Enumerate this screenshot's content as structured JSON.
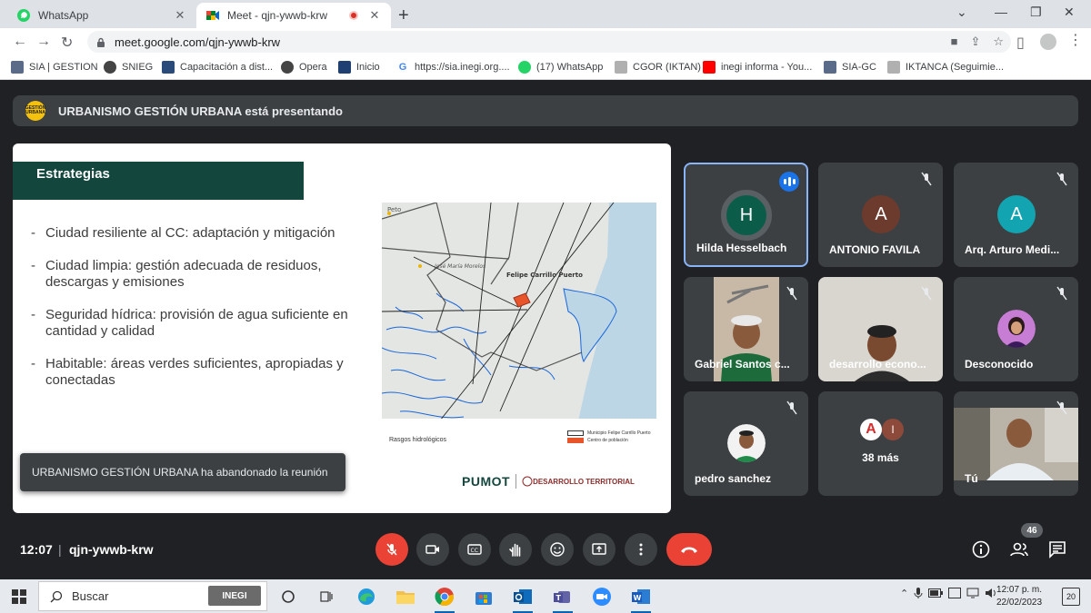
{
  "browser": {
    "tabs": [
      {
        "title": "WhatsApp",
        "active": false
      },
      {
        "title": "Meet - qjn-ywwb-krw",
        "active": true
      }
    ],
    "url": "meet.google.com/qjn-ywwb-krw",
    "bookmarks": [
      "SIA | GESTION",
      "SNIEG",
      "Capacitación a dist...",
      "Opera",
      "Inicio",
      "https://sia.inegi.org....",
      "(17) WhatsApp",
      "CGOR (IKTAN)",
      "inegi informa - You...",
      "SIA-GC",
      "IKTANCA (Seguimie..."
    ]
  },
  "meet": {
    "presenting_text": "URBANISMO GESTIÓN URBANA está presentando",
    "presenter_logo_text": "GESTIÓN URBANA",
    "slide": {
      "title": "Estrategias",
      "bullets": [
        "Ciudad resiliente al CC: adaptación y mitigación",
        "Ciudad limpia: gestión adecuada de residuos, descargas y emisiones",
        "Seguridad hídrica: provisión de agua suficiente en cantidad y calidad",
        "Habitable: áreas verdes suficientes, apropiadas y conectadas"
      ],
      "map_labels": {
        "peto": "Peto",
        "jose_maria": "José María Morelos",
        "felipe": "Felipe Carrillo Puerto"
      },
      "map_caption": "Rasgos hidrológicos",
      "map_legend": [
        "Municipio Felipe Carrillo Puerto",
        "Centro de población"
      ],
      "footer_brand": "PUMOT",
      "footer_org": "DESARROLLO TERRITORIAL"
    },
    "toast": "URBANISMO GESTIÓN URBANA ha abandonado la reunión",
    "participants": [
      {
        "name": "Hilda Hesselbach",
        "initial": "H",
        "color": "#0b5d4a"
      },
      {
        "name": "ANTONIO FAVILA",
        "initial": "A",
        "color": "#6d3b2e"
      },
      {
        "name": "Arq. Arturo Medi...",
        "initial": "A",
        "color": "#12a4b0"
      },
      {
        "name": "Gabriel Santos c..."
      },
      {
        "name": "desarrollo econo..."
      },
      {
        "name": "Desconocido"
      },
      {
        "name": "pedro sanchez"
      },
      {
        "name": "38 más",
        "initials": [
          "A",
          "I"
        ]
      },
      {
        "name": "Tú"
      }
    ],
    "clock": "12:07",
    "separator": "|",
    "meeting_code": "qjn-ywwb-krw",
    "participant_count": "46",
    "accent_red": "#ea4335",
    "speaking_blue": "#8ab4f8"
  },
  "taskbar": {
    "search_placeholder": "Buscar",
    "search_chip": "INEGI",
    "time": "12:07 p. m.",
    "date": "22/02/2023",
    "notifications": "20"
  }
}
